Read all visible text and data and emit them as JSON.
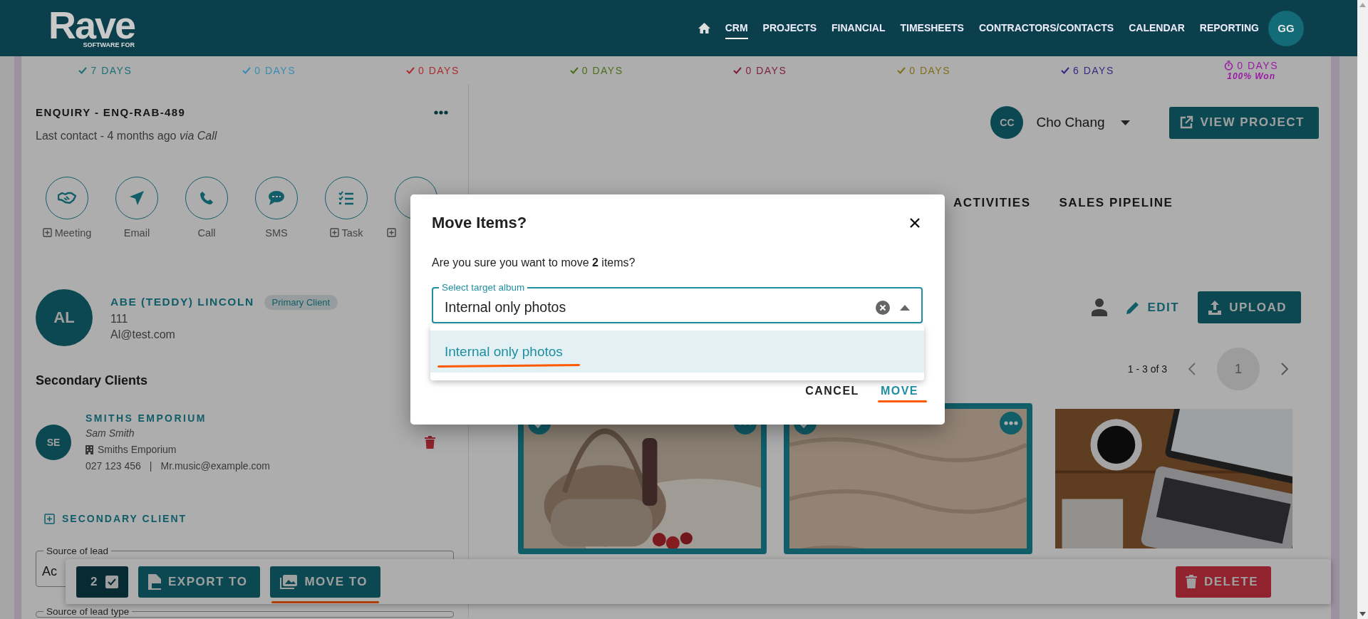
{
  "header": {
    "logo": "Rave",
    "logo_tagline": "SOFTWARE FOR",
    "nav": [
      {
        "kind": "home",
        "selected": false
      },
      {
        "kind": "text",
        "label": "CRM",
        "selected": true
      },
      {
        "kind": "text",
        "label": "PROJECTS",
        "selected": false
      },
      {
        "kind": "text",
        "label": "FINANCIAL",
        "selected": false
      },
      {
        "kind": "text",
        "label": "TIMESHEETS",
        "selected": false
      },
      {
        "kind": "text",
        "label": "CONTRACTORS/CONTACTS",
        "selected": false
      },
      {
        "kind": "text",
        "label": "CALENDAR",
        "selected": false
      },
      {
        "kind": "text",
        "label": "REPORTING",
        "selected": false
      }
    ],
    "avatar": "GG"
  },
  "stages": [
    {
      "label": "7 DAYS",
      "kind": "check",
      "color": "#1a6f74"
    },
    {
      "label": "0 DAYS",
      "kind": "check",
      "color": "#3a8cb4"
    },
    {
      "label": "0 DAYS",
      "kind": "check",
      "color": "#ab2c2e"
    },
    {
      "label": "0 DAYS",
      "kind": "check",
      "color": "#4a6e1c"
    },
    {
      "label": "0 DAYS",
      "kind": "check",
      "color": "#7e1c40"
    },
    {
      "label": "0 DAYS",
      "kind": "check",
      "color": "#7e6e1a"
    },
    {
      "label": "6 DAYS",
      "kind": "check",
      "color": "#352880"
    },
    {
      "label": "0 DAYS",
      "kind": "timer",
      "color": "#9a1aa6",
      "note": "100% Won"
    }
  ],
  "enquiry": {
    "title": "ENQUIRY - ENQ-RAB-489",
    "last_contact": "Last contact - 4 months ago *via Call*"
  },
  "actions": [
    {
      "label": "Meeting",
      "kind": "handshake",
      "add": true
    },
    {
      "label": "Email",
      "kind": "send",
      "add": false
    },
    {
      "label": "Call",
      "kind": "phone",
      "add": false
    },
    {
      "label": "SMS",
      "kind": "sms",
      "add": false
    },
    {
      "label": "Task",
      "kind": "tasks",
      "add": true
    },
    {
      "kind": "none",
      "add": true
    }
  ],
  "primary_client": {
    "initials": "AL",
    "name": "ABE (TEDDY) LINCOLN",
    "badge": "Primary Client",
    "phone": "111",
    "email": "Al@test.com"
  },
  "secondary": {
    "heading": "Secondary Clients",
    "clients": [
      {
        "initials": "SE",
        "name": "SMITHS EMPORIUM",
        "contact": "Sam Smith",
        "company": "Smiths Emporium",
        "phone": "027 123 456",
        "separator": "|",
        "email": "Mr.music@example.com"
      }
    ],
    "add_button": "SECONDARY CLIENT"
  },
  "fields": [
    {
      "label": "Source of lead",
      "value": "Ac"
    },
    {
      "label": "Source of lead type"
    }
  ],
  "owner": {
    "initials": "CC",
    "name": "Cho Chang"
  },
  "view_project": "VIEW PROJECT",
  "tabs": [
    {
      "label": "ACTIVITIES",
      "selected": false
    },
    {
      "label": "SALES PIPELINE",
      "selected": false
    }
  ],
  "toolbar": {
    "edit": "EDIT",
    "upload": "UPLOAD"
  },
  "pagination": {
    "range": "1 - 3 of 3",
    "pages": [
      {
        "label": "1",
        "selected": true
      }
    ]
  },
  "photos": [
    {
      "kind": "picture",
      "selected": true
    },
    {
      "kind": "picture",
      "selected": true
    },
    {
      "kind": "picture",
      "selected": false
    }
  ],
  "selection_bar": {
    "count": "2",
    "buttons": [
      {
        "label": "EXPORT TO",
        "kind": "pdf",
        "annotated": false
      },
      {
        "label": "MOVE TO",
        "kind": "images",
        "annotated": true
      }
    ],
    "delete": "DELETE"
  },
  "dialog": {
    "title": "Move Items?",
    "message": "Are you sure you want to move **2** items?",
    "field": {
      "label": "Select target album",
      "value": "Internal only photos",
      "expanded": true
    },
    "options": [
      {
        "label": "Internal only photos",
        "selected": true,
        "annotated": true
      }
    ],
    "actions": [
      {
        "label": "CANCEL",
        "kind": "text",
        "annotated": false
      },
      {
        "label": "MOVE",
        "kind": "primary",
        "annotated": true
      }
    ]
  }
}
